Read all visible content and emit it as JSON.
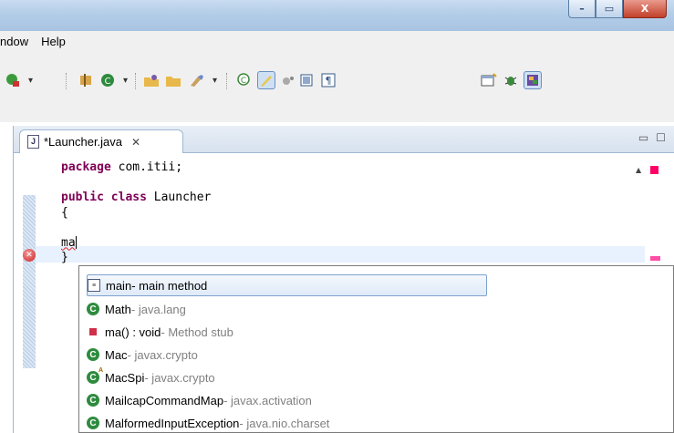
{
  "window": {
    "minimize_icon": "minimize-icon",
    "maximize_icon": "maximize-icon",
    "close_icon": "close-icon",
    "minimize_glyph": "–",
    "maximize_glyph": "▭",
    "close_glyph": "X"
  },
  "menu": {
    "items": [
      "ndow",
      "Help"
    ]
  },
  "editor": {
    "tab_label": "*Launcher.java",
    "tab_icon_glyph": "J",
    "tab_close_glyph": "✕",
    "minimize_glyph": "▭",
    "maximize_glyph": "☐",
    "code": {
      "line1_kw": "package",
      "line1_rest": " com.itii;",
      "line3_kw1": "public",
      "line3_kw2": "class",
      "line3_rest": " Launcher",
      "line4": "{",
      "line6_typed": "ma",
      "line7": "}"
    },
    "error_marker_glyph": "✕"
  },
  "autocomplete": {
    "items": [
      {
        "icon": "template-icon",
        "label": "main",
        "detail": " - main method",
        "selected": true
      },
      {
        "icon": "class-icon",
        "label": "Math",
        "detail": " - java.lang"
      },
      {
        "icon": "method-icon",
        "label": "ma() : void",
        "detail": " - Method stub"
      },
      {
        "icon": "class-icon",
        "label": "Mac",
        "detail": " - javax.crypto"
      },
      {
        "icon": "abstract-class-icon",
        "label": "MacSpi",
        "detail": " - javax.crypto"
      },
      {
        "icon": "class-icon",
        "label": "MailcapCommandMap",
        "detail": " - javax.activation"
      },
      {
        "icon": "class-icon",
        "label": "MalformedInputException",
        "detail": " - java.nio.charset"
      }
    ]
  },
  "colors": {
    "keyword": "#7f0055",
    "error": "#cc2222",
    "class_icon": "#2e8b3e"
  }
}
